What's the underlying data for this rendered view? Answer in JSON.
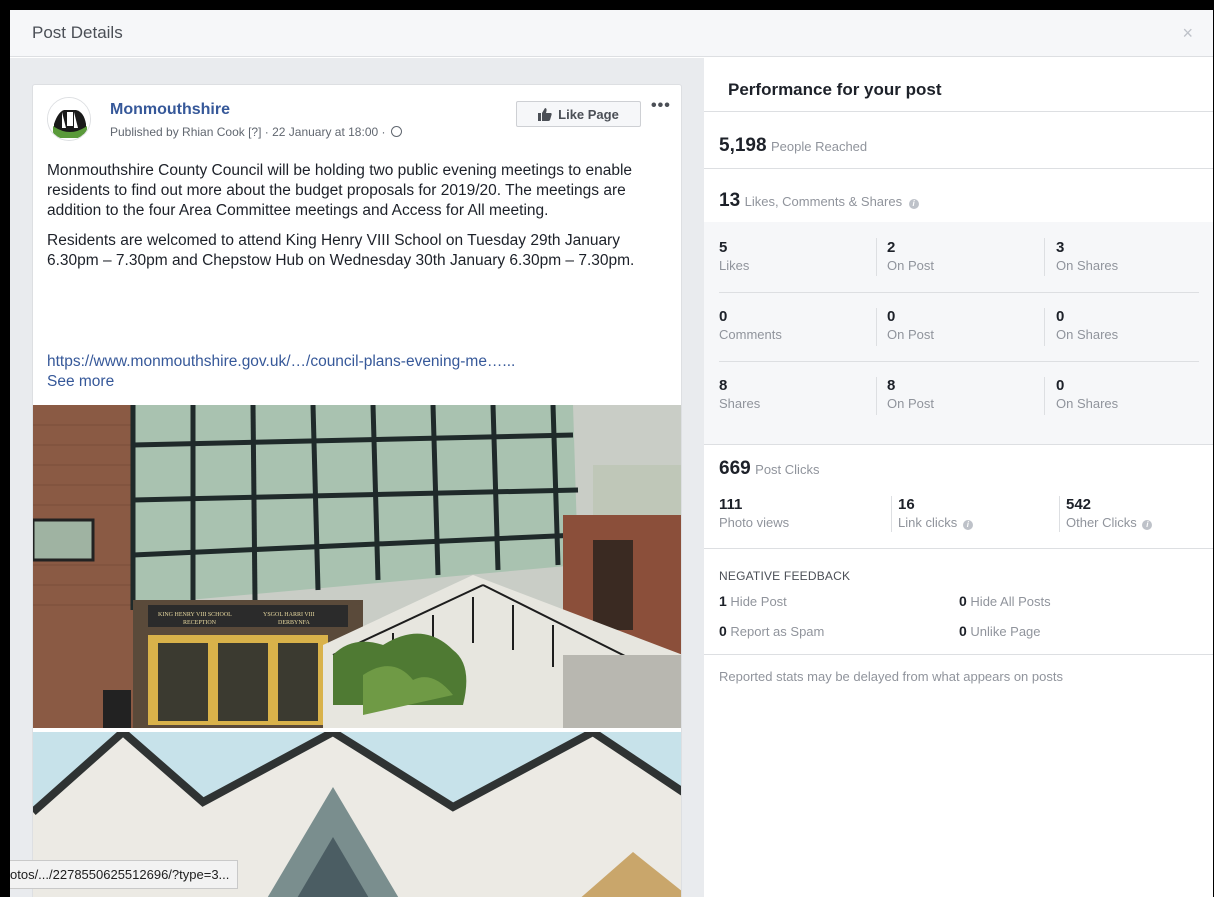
{
  "dialog": {
    "title": "Post Details",
    "close": "×"
  },
  "post": {
    "page_name": "Monmouthshire",
    "meta": "Published by Rhian Cook [?] · 22 January at 18:00 · ",
    "like_page_label": "Like Page",
    "more_label": "•••",
    "paragraph1": "Monmouthshire County Council will be holding two public evening meetings to enable residents to find out more about the budget proposals for 2019/20. The meetings are addition to the four Area Committee meetings and Access for All meeting.",
    "paragraph2": "Residents are welcomed to attend King Henry VIII School on Tuesday 29th January 6.30pm – 7.30pm and Chepstow Hub on Wednesday 30th January 6.30pm – 7.30pm.",
    "link": "https://www.monmouthshire.gov.uk/…/council-plans-evening-me…...",
    "see_more": "See more",
    "sign_line1": "KING HENRY VIII SCHOOL",
    "sign_line2": "RECEPTION",
    "sign_line3": "YSGOL HARRI VIII",
    "sign_line4": "DERBYNFA"
  },
  "status_bar": {
    "url": "otos/.../2278550625512696/?type=3..."
  },
  "performance": {
    "title": "Performance for your post",
    "reached_value": "5,198",
    "reached_label": "People Reached",
    "engagement_value": "13",
    "engagement_label": "Likes, Comments & Shares",
    "rows": [
      {
        "cells": [
          {
            "n": "5",
            "l": "Likes"
          },
          {
            "n": "2",
            "l": "On Post"
          },
          {
            "n": "3",
            "l": "On Shares"
          }
        ]
      },
      {
        "cells": [
          {
            "n": "0",
            "l": "Comments"
          },
          {
            "n": "0",
            "l": "On Post"
          },
          {
            "n": "0",
            "l": "On Shares"
          }
        ]
      },
      {
        "cells": [
          {
            "n": "8",
            "l": "Shares"
          },
          {
            "n": "8",
            "l": "On Post"
          },
          {
            "n": "0",
            "l": "On Shares"
          }
        ]
      }
    ],
    "clicks_value": "669",
    "clicks_label": "Post Clicks",
    "click_cells": [
      {
        "n": "111",
        "l": "Photo views"
      },
      {
        "n": "16",
        "l": "Link clicks"
      },
      {
        "n": "542",
        "l": "Other Clicks"
      }
    ],
    "negative_title": "NEGATIVE FEEDBACK",
    "negative": [
      {
        "n": "1",
        "l": "Hide Post"
      },
      {
        "n": "0",
        "l": "Hide All Posts"
      },
      {
        "n": "0",
        "l": "Report as Spam"
      },
      {
        "n": "0",
        "l": "Unlike Page"
      }
    ],
    "disclaimer": "Reported stats may be delayed from what appears on posts"
  }
}
